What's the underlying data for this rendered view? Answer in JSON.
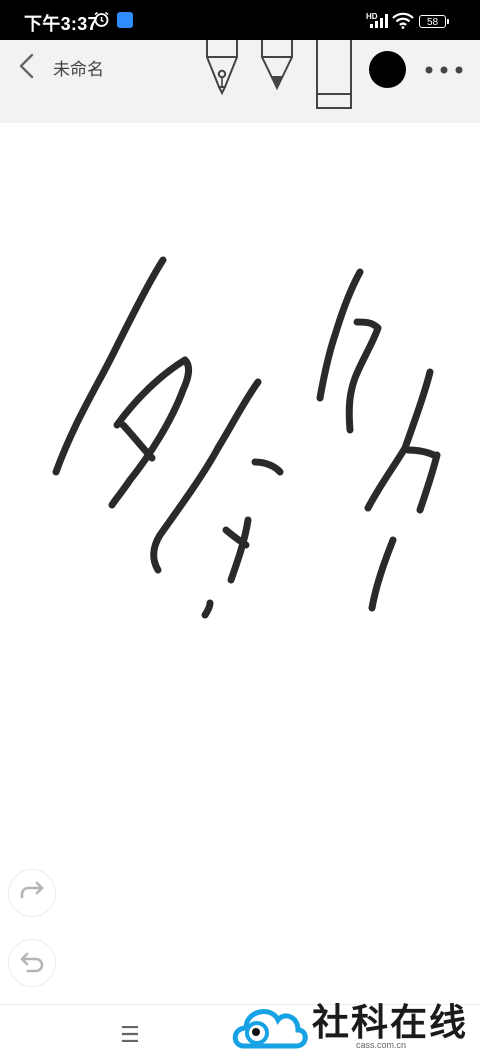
{
  "status": {
    "time": "下午3:37",
    "network_label": "HD",
    "battery": "58"
  },
  "toolbar": {
    "title": "未命名",
    "selected_color": "#000000",
    "tools": [
      "pen-tool",
      "marker-tool",
      "eraser-tool"
    ]
  },
  "canvas": {
    "stroke_color": "#2a2a2a",
    "redo_icon": "redo-icon",
    "undo_icon": "undo-icon"
  },
  "bottom": {
    "menu_icon": "☰",
    "watermark": {
      "title": "社科在线",
      "subtitle": "cass.com.cn"
    }
  }
}
